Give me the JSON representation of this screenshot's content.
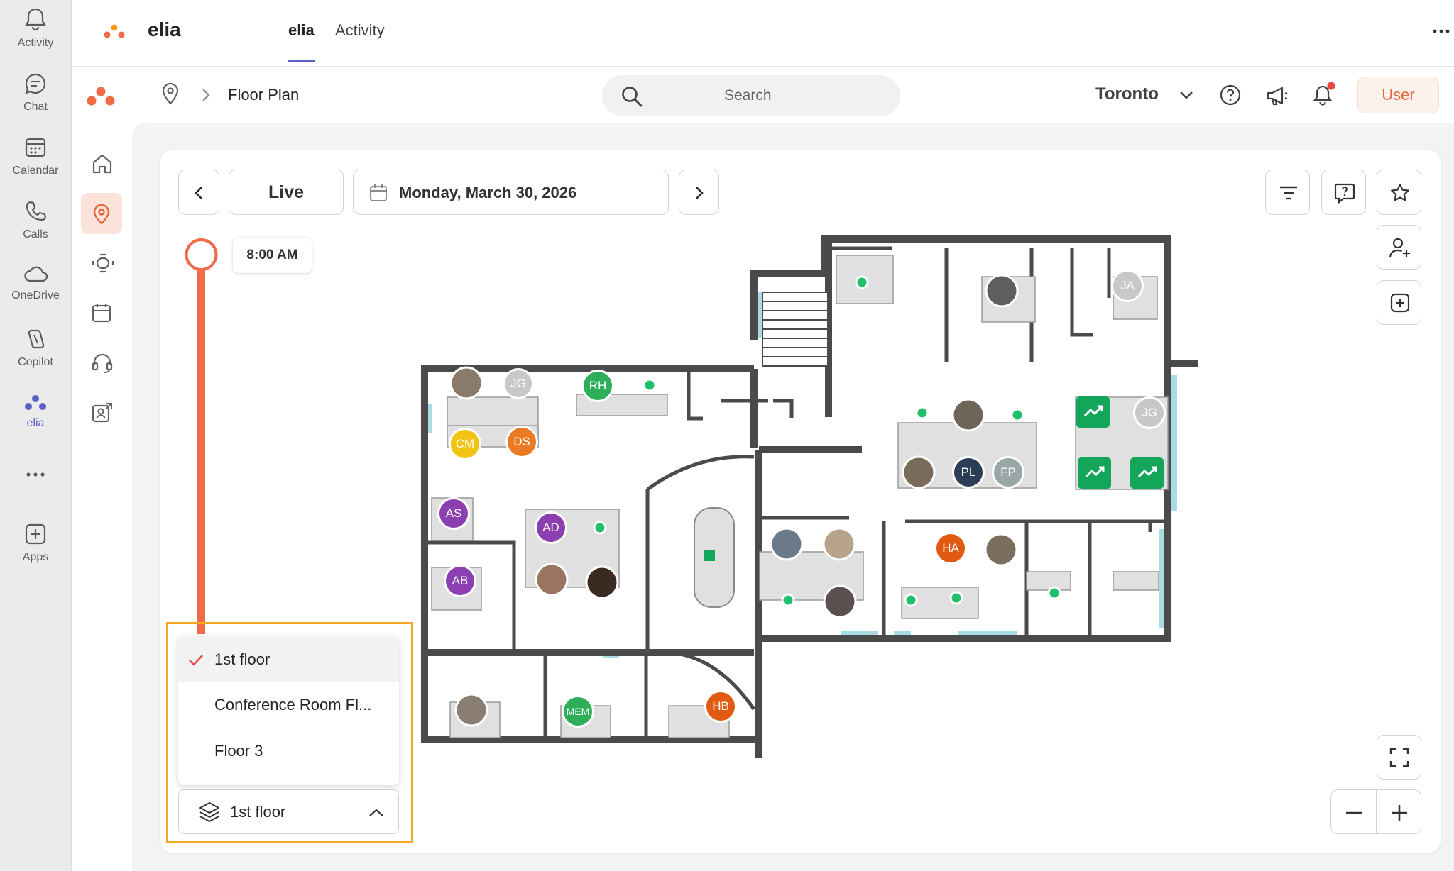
{
  "rail": {
    "items": [
      {
        "label": "Activity",
        "icon": "bell-icon"
      },
      {
        "label": "Chat",
        "icon": "chat-icon"
      },
      {
        "label": "Calendar",
        "icon": "calendar-icon"
      },
      {
        "label": "Calls",
        "icon": "phone-icon"
      },
      {
        "label": "OneDrive",
        "icon": "cloud-icon"
      },
      {
        "label": "Copilot",
        "icon": "copilot-icon"
      },
      {
        "label": "elia",
        "icon": "elia-icon",
        "active": true
      },
      {
        "label": "",
        "icon": "more-icon"
      },
      {
        "label": "Apps",
        "icon": "add-apps-icon"
      }
    ]
  },
  "topbar": {
    "app_name": "elia",
    "tabs": [
      {
        "label": "elia",
        "active": true
      },
      {
        "label": "Activity"
      }
    ]
  },
  "header": {
    "breadcrumb_title": "Floor Plan",
    "search_placeholder": "Search",
    "location": "Toronto",
    "user_label": "User",
    "notification_dot_color": "#e8483f"
  },
  "toolbar": {
    "live_label": "Live",
    "date_label": "Monday, March 30, 2026",
    "time_label": "8:00 AM"
  },
  "floor_selector": {
    "options": [
      "1st floor",
      "Conference Room Fl...",
      "Floor 3"
    ],
    "selected": "1st floor"
  },
  "floorplan": {
    "people": [
      {
        "initials": "JG",
        "color": "#c8c8c8"
      },
      {
        "initials": "RH",
        "color": "#2eae58"
      },
      {
        "initials": "CM",
        "color": "#f2c311"
      },
      {
        "initials": "DS",
        "color": "#ec7a22"
      },
      {
        "initials": "AS",
        "color": "#8c3fb0"
      },
      {
        "initials": "AD",
        "color": "#8c3fb0"
      },
      {
        "initials": "AB",
        "color": "#8c3fb0"
      },
      {
        "initials": "MEM",
        "color": "#2eae58"
      },
      {
        "initials": "HB",
        "color": "#e05a12"
      },
      {
        "initials": "PL",
        "color": "#2c3e57"
      },
      {
        "initials": "FP",
        "color": "#9aa5a5"
      },
      {
        "initials": "JG",
        "color": "#c8c8c8"
      },
      {
        "initials": "JA",
        "color": "#c8c8c8"
      },
      {
        "initials": "HA",
        "color": "#e05a12"
      }
    ]
  },
  "colors": {
    "accent": "#f26b47",
    "teams_purple": "#5b5fc7",
    "available_green": "#1fbf6b",
    "wall": "#4a4a4a",
    "window": "#a9dbe3"
  }
}
